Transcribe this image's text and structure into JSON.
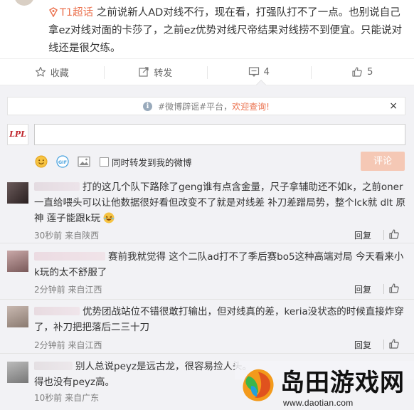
{
  "post": {
    "topic": "T1超话",
    "text": "之前说新人AD对线不行，现在看，打强队打不了一点。也别说自己拿ez对线对面的卡莎了，之前ez优势对线尺帝结果对线捞不到便宜。只能说对线还是很欠练。"
  },
  "actions": [
    {
      "label": "收藏",
      "icon": "star-icon"
    },
    {
      "label": "转发",
      "icon": "repost-icon"
    },
    {
      "label": "4",
      "icon": "comment-icon"
    },
    {
      "label": "5",
      "icon": "thumbs-up-icon"
    }
  ],
  "notice": {
    "prefix": "#微博辟谣#平台，",
    "highlight": "欢迎查询!",
    "close": "×"
  },
  "composer": {
    "avatar_text": "LPL",
    "input_value": "",
    "input_placeholder": "",
    "repost_label": "同时转发到我的微博",
    "submit_label": "评论"
  },
  "comments": [
    {
      "text": "打的这几个队下路除了geng谁有点含金量，尺子拿辅助还不如k，之前oner一直给喂头可以让他数据很好看但改变不了就是对线差 补刀差蹭局势，整个lck就 dlt 原神 莲子能跟k玩",
      "time": "30秒前",
      "from": "来自陕西",
      "reply": "回复",
      "has_emoji": true
    },
    {
      "text": "赛前我就觉得 这个二队ad打不了季后赛bo5这种高端对局 今天看来小k玩的太不舒服了",
      "time": "2分钟前",
      "from": "来自江西",
      "reply": "回复",
      "has_emoji": false
    },
    {
      "text": "优势团战站位不错很敢打输出，但对线真的差，keria没状态的时候直接炸穿了，补刀把把落后二三十刀",
      "time": "2分钟前",
      "from": "来自江西",
      "reply": "回复",
      "has_emoji": false
    },
    {
      "text": "别人总说peyz是远古龙，很容易捡人头。",
      "text2": "得也没有peyz高。",
      "time": "10秒前",
      "from": "来自广东",
      "reply": "回复",
      "has_emoji": false
    }
  ],
  "watermark": {
    "title": "岛田游戏网",
    "url": "www.daotian.com"
  },
  "colors": {
    "accent": "#eb7350",
    "submit_disabled": "#f5c8b5",
    "panel_bg": "#f2f2f5"
  }
}
